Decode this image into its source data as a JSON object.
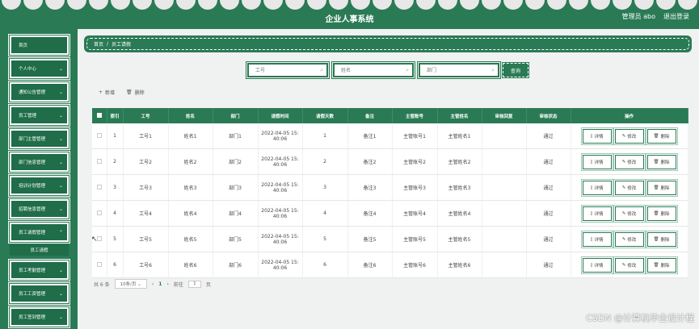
{
  "header": {
    "title": "企业人事系统",
    "admin_label": "管理员 abo",
    "logout_label": "退出登录"
  },
  "sidebar": {
    "items": [
      {
        "label": "首页",
        "has_children": false
      },
      {
        "label": "个人中心",
        "has_children": true
      },
      {
        "label": "通知公告管理",
        "has_children": true
      },
      {
        "label": "员工管理",
        "has_children": true
      },
      {
        "label": "部门主管管理",
        "has_children": true
      },
      {
        "label": "部门信息管理",
        "has_children": true
      },
      {
        "label": "培训计划管理",
        "has_children": true
      },
      {
        "label": "招聘信息管理",
        "has_children": true
      },
      {
        "label": "员工请假管理",
        "has_children": true
      },
      {
        "label": "员工考勤管理",
        "has_children": true
      },
      {
        "label": "员工工资管理",
        "has_children": true
      },
      {
        "label": "员工签到管理",
        "has_children": true
      }
    ],
    "submenu_label": "员工请假"
  },
  "breadcrumb": {
    "home": "首页",
    "separator": "/",
    "current": "员工请假"
  },
  "search": {
    "field1_placeholder": "工号",
    "field2_placeholder": "姓名",
    "field3_placeholder": "部门",
    "query_label": "查询"
  },
  "actions": {
    "add_label": "新增",
    "delete_label": "删除"
  },
  "table": {
    "headers": [
      "索引",
      "工号",
      "姓名",
      "部门",
      "请假时间",
      "请假天数",
      "备注",
      "主管账号",
      "主管姓名",
      "审核回复",
      "审核状态",
      "操作"
    ],
    "rows": [
      {
        "index": "1",
        "emp_no": "工号1",
        "name": "姓名1",
        "dept": "部门1",
        "time1": "2022-04-05 15:",
        "time2": "40:06",
        "days": "1",
        "note": "备注1",
        "mgr_acct": "主管账号1",
        "mgr_name": "主管姓名1",
        "reply": "",
        "status": "通过"
      },
      {
        "index": "2",
        "emp_no": "工号2",
        "name": "姓名2",
        "dept": "部门2",
        "time1": "2022-04-05 15:",
        "time2": "40:06",
        "days": "2",
        "note": "备注2",
        "mgr_acct": "主管账号2",
        "mgr_name": "主管姓名2",
        "reply": "",
        "status": "通过"
      },
      {
        "index": "3",
        "emp_no": "工号3",
        "name": "姓名3",
        "dept": "部门3",
        "time1": "2022-04-05 15:",
        "time2": "40:06",
        "days": "3",
        "note": "备注3",
        "mgr_acct": "主管账号3",
        "mgr_name": "主管姓名3",
        "reply": "",
        "status": "通过"
      },
      {
        "index": "4",
        "emp_no": "工号4",
        "name": "姓名4",
        "dept": "部门4",
        "time1": "2022-04-05 15:",
        "time2": "40:06",
        "days": "4",
        "note": "备注4",
        "mgr_acct": "主管账号4",
        "mgr_name": "主管姓名4",
        "reply": "",
        "status": "通过"
      },
      {
        "index": "5",
        "emp_no": "工号5",
        "name": "姓名5",
        "dept": "部门5",
        "time1": "2022-04-05 15:",
        "time2": "40:06",
        "days": "5",
        "note": "备注5",
        "mgr_acct": "主管账号5",
        "mgr_name": "主管姓名5",
        "reply": "",
        "status": "通过"
      },
      {
        "index": "6",
        "emp_no": "工号6",
        "name": "姓名6",
        "dept": "部门6",
        "time1": "2022-04-05 15:",
        "time2": "40:06",
        "days": "6",
        "note": "备注6",
        "mgr_acct": "主管账号6",
        "mgr_name": "主管姓名6",
        "reply": "",
        "status": "通过"
      }
    ],
    "op_labels": {
      "detail": "详情",
      "edit": "修改",
      "delete": "删除"
    }
  },
  "pagination": {
    "total": "共 6 条",
    "page_size": "10条/页",
    "current_page": "1",
    "goto_label": "前往",
    "goto_value": "1",
    "page_suffix": "页"
  },
  "watermark": "CSDN @计算机毕业设计程",
  "colors": {
    "primary": "#2a7a55",
    "dark": "#1f6d49"
  }
}
